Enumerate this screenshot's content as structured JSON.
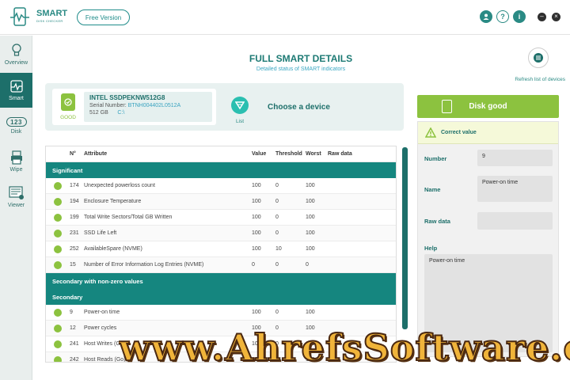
{
  "header": {
    "brand_title": "SMART",
    "brand_subtitle": "DISK CHECKER",
    "free_version_label": "Free Version",
    "icons": [
      "user-icon",
      "help-icon",
      "info-icon",
      "minimize-icon",
      "close-icon"
    ],
    "help_glyph": "?",
    "info_glyph": "i",
    "minimize_glyph": "–",
    "close_glyph": "×"
  },
  "sidebar": {
    "items": [
      {
        "label": "Overview",
        "icon": "bulb-icon"
      },
      {
        "label": "Smart",
        "icon": "pulse-icon",
        "active": true
      },
      {
        "label": "Disk",
        "icon": "disk-digits-icon",
        "glyph": "123"
      },
      {
        "label": "Wipe",
        "icon": "printer-icon"
      },
      {
        "label": "Viewer",
        "icon": "viewer-icon"
      }
    ]
  },
  "page": {
    "title": "FULL SMART DETAILS",
    "subtitle": "Detailed status of SMART indicators",
    "refresh_label": "Refresh list of devices"
  },
  "device": {
    "status": "GOOD",
    "name": "INTEL SSDPEKNW512G8",
    "serial_label": "Serial Number:",
    "serial_value": "BTNH004402L0512A",
    "size": "512 GB",
    "drive": "C:\\",
    "list_label": "List",
    "choose_label": "Choose a device"
  },
  "table": {
    "headers": {
      "num": "N°",
      "attribute": "Attribute",
      "value": "Value",
      "threshold": "Threshold",
      "worst": "Worst",
      "raw": "Raw data"
    },
    "section_significant": "Significant",
    "significant_rows": [
      {
        "num": "174",
        "attribute": "Unexpected powerloss count",
        "value": "100",
        "threshold": "0",
        "worst": "100"
      },
      {
        "num": "194",
        "attribute": "Enclosure Temperature",
        "value": "100",
        "threshold": "0",
        "worst": "100"
      },
      {
        "num": "199",
        "attribute": "Total Write Sectors/Total GB Written",
        "value": "100",
        "threshold": "0",
        "worst": "100"
      },
      {
        "num": "231",
        "attribute": "SSD Life Left",
        "value": "100",
        "threshold": "0",
        "worst": "100"
      },
      {
        "num": "252",
        "attribute": "AvailableSpare (NVME)",
        "value": "100",
        "threshold": "10",
        "worst": "100"
      },
      {
        "num": "15",
        "attribute": "Number of Error Information Log Entries (NVME)",
        "value": "0",
        "threshold": "0",
        "worst": "0"
      }
    ],
    "section_nonzero": "Secondary with non-zero values",
    "section_secondary": "Secondary",
    "secondary_rows": [
      {
        "num": "9",
        "attribute": "Power-on time",
        "value": "100",
        "threshold": "0",
        "worst": "100"
      },
      {
        "num": "12",
        "attribute": "Power cycles",
        "value": "100",
        "threshold": "0",
        "worst": "100"
      },
      {
        "num": "241",
        "attribute": "Host Writes (Go)",
        "value": "100",
        "threshold": "0",
        "worst": "100"
      },
      {
        "num": "242",
        "attribute": "Host Reads (Go)",
        "value": "100",
        "threshold": "0",
        "worst": "100"
      }
    ]
  },
  "detail": {
    "disk_status": "Disk good",
    "correct_value": "Correct value",
    "number_label": "Number",
    "number_value": "9",
    "name_label": "Name",
    "name_value": "Power-on time",
    "raw_label": "Raw data",
    "raw_value": "",
    "help_label": "Help",
    "help_value": "Power-on time"
  },
  "watermark": "www.AhrefsSoftware.com",
  "colors": {
    "accent": "#1d6f6a",
    "good": "#8cc23f",
    "section": "#15867f",
    "link": "#39a3c0"
  }
}
